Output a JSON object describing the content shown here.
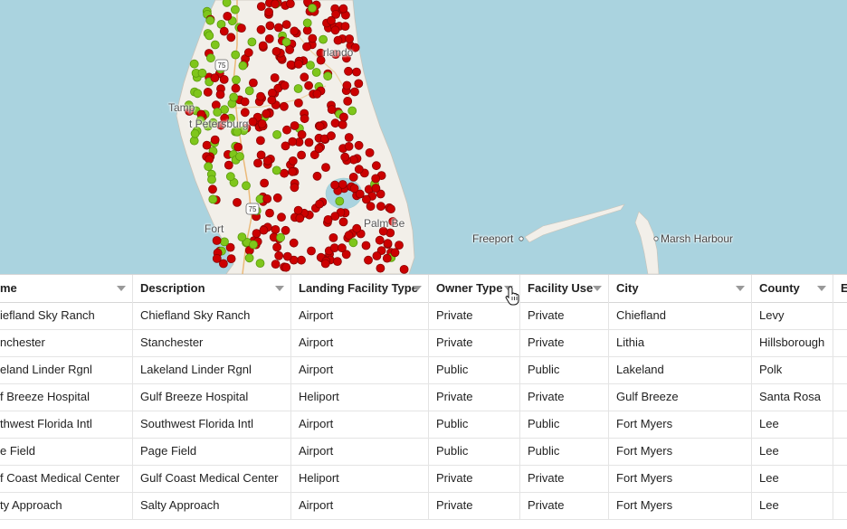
{
  "map": {
    "labels": {
      "orlando": "rlando",
      "tampa": "Tamp",
      "st_petersburg": "t Petersburg",
      "fort_myers": "Fort",
      "palm_beach": "Palm Be",
      "freeport": "Freeport",
      "marsh_harbour": "Marsh Harbour",
      "route_75": "75"
    },
    "colors": {
      "water": "#aad3df",
      "land": "#f2efe9",
      "public_marker": "#cc0000",
      "private_marker": "#7fc61b"
    }
  },
  "table": {
    "columns": [
      "me",
      "Description",
      "Landing Facility Type",
      "Owner Type",
      "Facility Use",
      "City",
      "County",
      "E"
    ],
    "rows": [
      [
        "iefland Sky Ranch",
        "Chiefland Sky Ranch",
        "Airport",
        "Private",
        "Private",
        "Chiefland",
        "Levy",
        ""
      ],
      [
        "nchester",
        "Stanchester",
        "Airport",
        "Private",
        "Private",
        "Lithia",
        "Hillsborough",
        ""
      ],
      [
        "eland Linder Rgnl",
        "Lakeland Linder Rgnl",
        "Airport",
        "Public",
        "Public",
        "Lakeland",
        "Polk",
        ""
      ],
      [
        "f Breeze Hospital",
        "Gulf Breeze Hospital",
        "Heliport",
        "Private",
        "Private",
        "Gulf Breeze",
        "Santa Rosa",
        ""
      ],
      [
        "thwest Florida Intl",
        "Southwest Florida Intl",
        "Airport",
        "Public",
        "Public",
        "Fort Myers",
        "Lee",
        ""
      ],
      [
        "e Field",
        "Page Field",
        "Airport",
        "Public",
        "Public",
        "Fort Myers",
        "Lee",
        ""
      ],
      [
        "f Coast Medical Center",
        "Gulf Coast Medical Center",
        "Heliport",
        "Private",
        "Private",
        "Fort Myers",
        "Lee",
        ""
      ],
      [
        "ty Approach",
        "Salty Approach",
        "Airport",
        "Private",
        "Private",
        "Fort Myers",
        "Lee",
        ""
      ]
    ]
  }
}
